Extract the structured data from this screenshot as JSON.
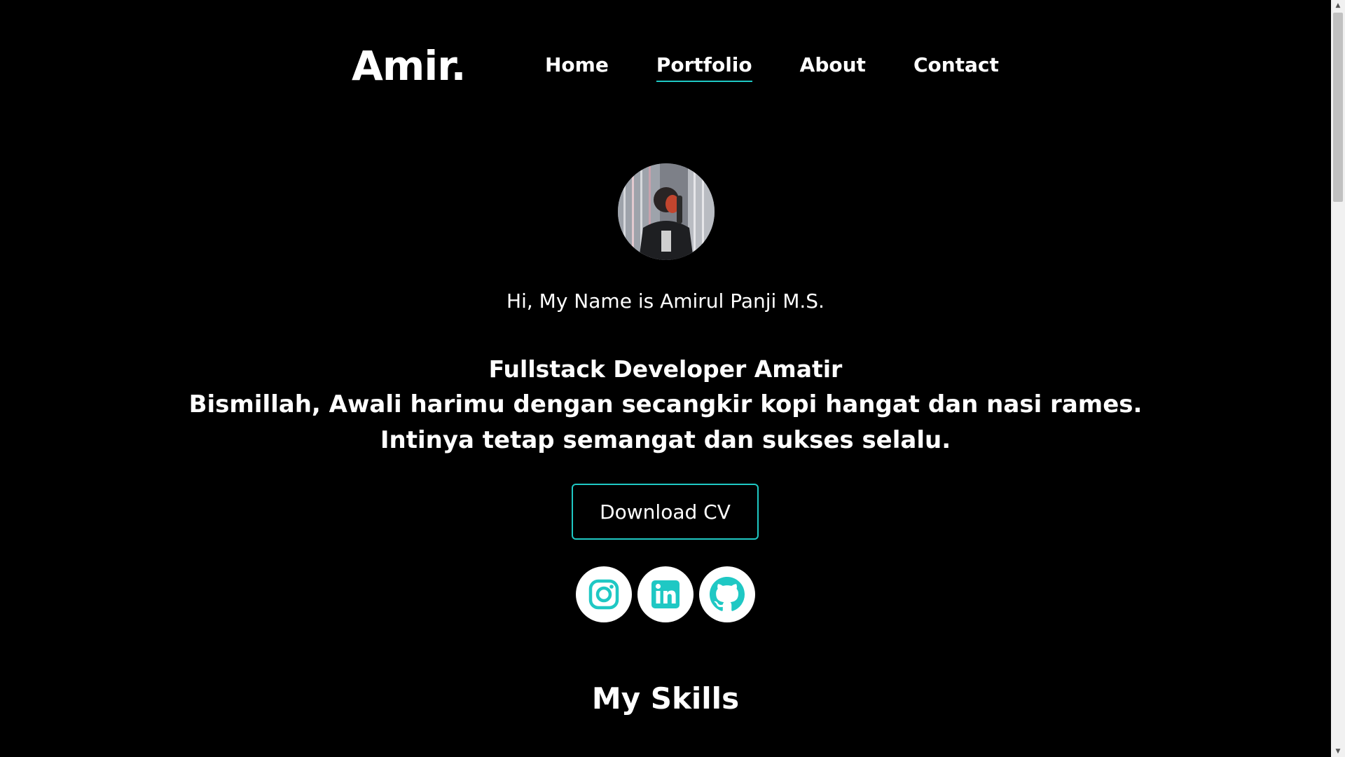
{
  "header": {
    "logo": "Amir.",
    "nav": [
      {
        "label": "Home",
        "active": false
      },
      {
        "label": "Portfolio",
        "active": true
      },
      {
        "label": "About",
        "active": false
      },
      {
        "label": "Contact",
        "active": false
      }
    ]
  },
  "hero": {
    "greeting": "Hi, My Name is Amirul Panji M.S.",
    "tagline": [
      "Fullstack Developer Amatir",
      "Bismillah, Awali harimu dengan secangkir kopi hangat dan nasi rames.",
      "Intinya tetap semangat dan sukses selalu."
    ],
    "cv_button": "Download CV",
    "socials": [
      {
        "icon": "instagram-icon"
      },
      {
        "icon": "linkedin-icon"
      },
      {
        "icon": "github-icon"
      }
    ]
  },
  "skills": {
    "title": "My Skills"
  },
  "colors": {
    "background": "#000000",
    "text": "#ffffff",
    "accent": "#1fc8c4"
  }
}
